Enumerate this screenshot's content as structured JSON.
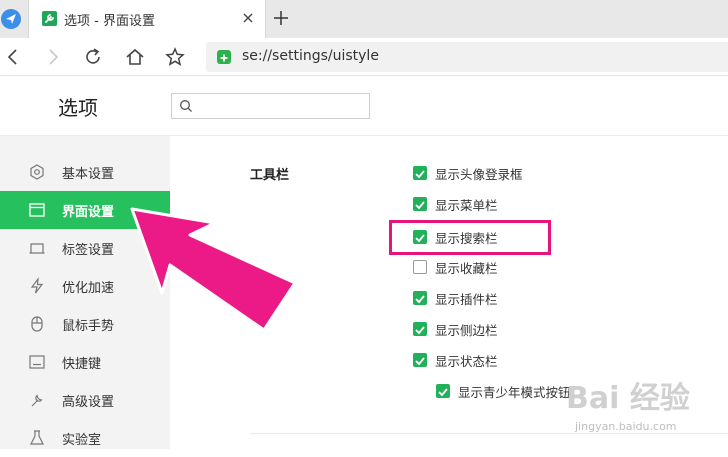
{
  "tab": {
    "title": "选项 - 界面设置"
  },
  "address": {
    "url": "se://settings/uistyle"
  },
  "page": {
    "title": "选项",
    "search_placeholder": ""
  },
  "sidebar": {
    "items": [
      {
        "label": "基本设置",
        "icon": "settings-icon"
      },
      {
        "label": "界面设置",
        "icon": "layout-icon",
        "active": true
      },
      {
        "label": "标签设置",
        "icon": "tab-icon"
      },
      {
        "label": "优化加速",
        "icon": "bolt-icon"
      },
      {
        "label": "鼠标手势",
        "icon": "mouse-icon"
      },
      {
        "label": "快捷键",
        "icon": "keyboard-icon"
      },
      {
        "label": "高级设置",
        "icon": "wrench-icon"
      },
      {
        "label": "实验室",
        "icon": "flask-icon"
      }
    ]
  },
  "toolbar_section": {
    "label": "工具栏",
    "options": [
      {
        "label": "显示头像登录框",
        "checked": true
      },
      {
        "label": "显示菜单栏",
        "checked": true
      },
      {
        "label": "显示搜索栏",
        "checked": true
      },
      {
        "label": "显示收藏栏",
        "checked": false
      },
      {
        "label": "显示插件栏",
        "checked": true
      },
      {
        "label": "显示侧边栏",
        "checked": true
      },
      {
        "label": "显示状态栏",
        "checked": true
      },
      {
        "label": "显示青少年模式按钮",
        "checked": true
      }
    ]
  },
  "colors": {
    "accent": "#26c15e",
    "annotation": "#e5157d"
  },
  "watermark": {
    "brand": "Bai 经验",
    "url": "jingyan.baidu.com"
  }
}
